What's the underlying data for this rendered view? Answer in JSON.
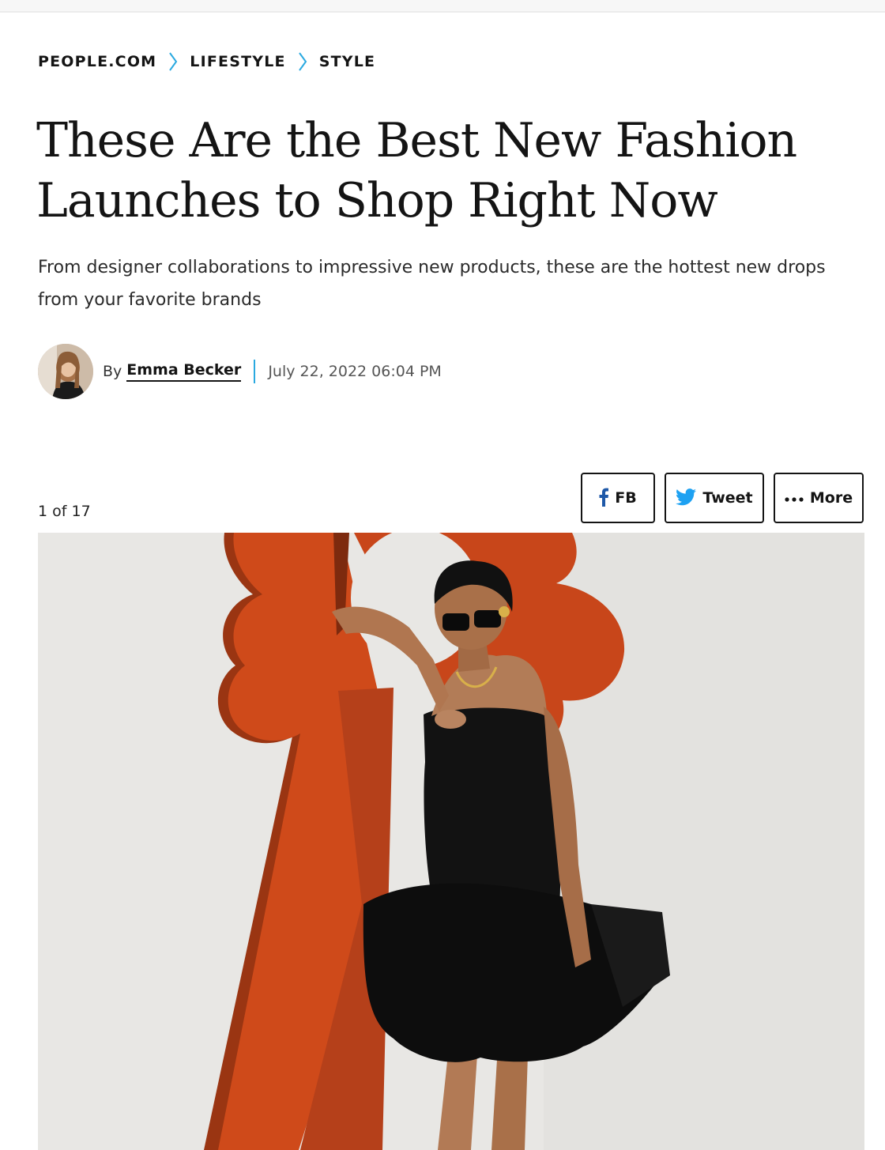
{
  "breadcrumb": {
    "items": [
      "PEOPLE.COM",
      "LIFESTYLE",
      "STYLE"
    ]
  },
  "article": {
    "headline": "These Are the Best New Fashion Launches to Shop Right Now",
    "dek": "From designer collaborations to impressive new products, these are the hottest new drops from your favorite brands"
  },
  "byline": {
    "by": "By",
    "author": "Emma Becker",
    "date": "July 22, 2022 06:04 PM"
  },
  "gallery": {
    "counter": "1 of 17"
  },
  "share": {
    "fb_label": "FB",
    "tweet_label": "Tweet",
    "more_label": "More"
  },
  "colors": {
    "accent": "#2aa9e0",
    "facebook": "#1f59a8",
    "twitter": "#1da1f2",
    "text": "#141414",
    "sculpture_orange": "#cf4a1a"
  },
  "icons": [
    "chevron-right-icon",
    "facebook-icon",
    "twitter-bird-icon",
    "ellipsis-icon"
  ]
}
